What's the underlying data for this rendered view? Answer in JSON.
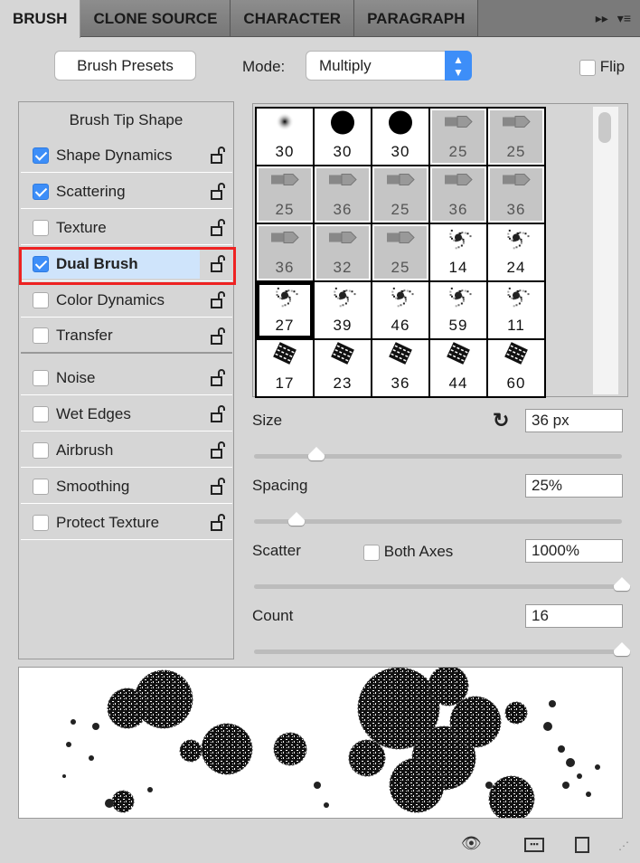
{
  "tabs": [
    {
      "label": "BRUSH",
      "active": true
    },
    {
      "label": "CLONE SOURCE"
    },
    {
      "label": "CHARACTER"
    },
    {
      "label": "PARAGRAPH"
    }
  ],
  "tab_icons": {
    "collapse": "double-arrow-icon",
    "menu": "panel-menu-icon"
  },
  "toolbar": {
    "brush_presets": "Brush Presets",
    "mode_label": "Mode:",
    "mode_value": "Multiply",
    "flip_label": "Flip",
    "flip_checked": false
  },
  "options": {
    "header": "Brush Tip Shape",
    "items": [
      {
        "label": "Shape Dynamics",
        "checked": true
      },
      {
        "label": "Scattering",
        "checked": true
      },
      {
        "label": "Texture",
        "checked": false
      },
      {
        "label": "Dual Brush",
        "checked": true,
        "selected": true
      },
      {
        "label": "Color Dynamics",
        "checked": false
      },
      {
        "label": "Transfer",
        "checked": false
      },
      {
        "label": "Noise",
        "checked": false
      },
      {
        "label": "Wet Edges",
        "checked": false
      },
      {
        "label": "Airbrush",
        "checked": false
      },
      {
        "label": "Smoothing",
        "checked": false
      },
      {
        "label": "Protect Texture",
        "checked": false
      }
    ]
  },
  "brushes": [
    {
      "size": "30",
      "type": "soft"
    },
    {
      "size": "30",
      "type": "hard"
    },
    {
      "size": "30",
      "type": "hard"
    },
    {
      "size": "25",
      "type": "bristle"
    },
    {
      "size": "25",
      "type": "bristle"
    },
    {
      "size": "25",
      "type": "bristle"
    },
    {
      "size": "36",
      "type": "bristle"
    },
    {
      "size": "25",
      "type": "bristle"
    },
    {
      "size": "36",
      "type": "bristle"
    },
    {
      "size": "36",
      "type": "bristle"
    },
    {
      "size": "36",
      "type": "bristle"
    },
    {
      "size": "32",
      "type": "bristle"
    },
    {
      "size": "25",
      "type": "bristle"
    },
    {
      "size": "14",
      "type": "scatter"
    },
    {
      "size": "24",
      "type": "scatter"
    },
    {
      "size": "27",
      "type": "scatter",
      "current": true
    },
    {
      "size": "39",
      "type": "scatter"
    },
    {
      "size": "46",
      "type": "scatter"
    },
    {
      "size": "59",
      "type": "scatter"
    },
    {
      "size": "11",
      "type": "scatter"
    },
    {
      "size": "17",
      "type": "chalk"
    },
    {
      "size": "23",
      "type": "chalk"
    },
    {
      "size": "36",
      "type": "chalk"
    },
    {
      "size": "44",
      "type": "chalk"
    },
    {
      "size": "60",
      "type": "chalk"
    }
  ],
  "controls": {
    "size_label": "Size",
    "size_value": "36 px",
    "size_slider": 0.17,
    "spacing_label": "Spacing",
    "spacing_value": "25%",
    "spacing_slider": 0.115,
    "scatter_label": "Scatter",
    "both_axes_label": "Both Axes",
    "both_axes_checked": false,
    "scatter_value": "1000%",
    "scatter_slider": 1.0,
    "count_label": "Count",
    "count_value": "16",
    "count_slider": 1.0
  },
  "footer_icons": [
    "eye-brush-icon",
    "grid-icon",
    "new-preset-icon"
  ]
}
